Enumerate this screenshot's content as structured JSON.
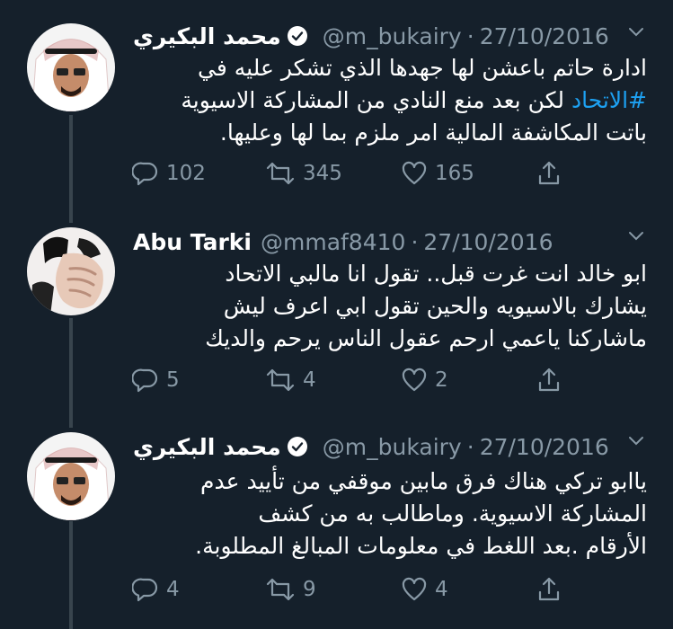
{
  "tweets": [
    {
      "name": "محمد البكيري",
      "verified": true,
      "handle": "@m_bukairy",
      "date": "27/10/2016",
      "lines": [
        "ادارة حاتم باعشن لها جهدها الذي تشكر عليه في",
        "لكن بعد منع النادي من المشاركة الاسيوية",
        "باتت المكاشفة المالية امر ملزم بما لها وعليها."
      ],
      "hashtag": "#الاتحاد",
      "replies": "102",
      "retweets": "345",
      "likes": "165"
    },
    {
      "name": "Abu Tarki",
      "verified": false,
      "handle": "@mmaf8410",
      "date": "27/10/2016",
      "lines": [
        "ابو خالد انت غرت قبل.. تقول انا مالبي الاتحاد",
        "يشارك بالاسيويه والحين تقول ابي اعرف ليش",
        "ماشاركنا ياعمي ارحم عقول الناس يرحم والديك"
      ],
      "replies": "5",
      "retweets": "4",
      "likes": "2"
    },
    {
      "name": "محمد البكيري",
      "verified": true,
      "handle": "@m_bukairy",
      "date": "27/10/2016",
      "lines": [
        "ياابو تركي هناك فرق مابين موقفي من تأييد عدم",
        "المشاركة الاسيوية. وماطالب به من كشف",
        "الأرقام .بعد اللغط في معلومات المبالغ المطلوبة."
      ],
      "replies": "4",
      "retweets": "9",
      "likes": "4"
    }
  ],
  "icons": {
    "reply": "reply-icon",
    "retweet": "retweet-icon",
    "like": "heart-icon",
    "share": "share-icon",
    "more": "chevron-down-icon",
    "verified": "verified-badge-icon"
  },
  "colors": {
    "background": "#15202b",
    "text": "#ffffff",
    "secondary": "#8899a6",
    "link": "#1da1f2",
    "thread_line": "#38444d"
  }
}
